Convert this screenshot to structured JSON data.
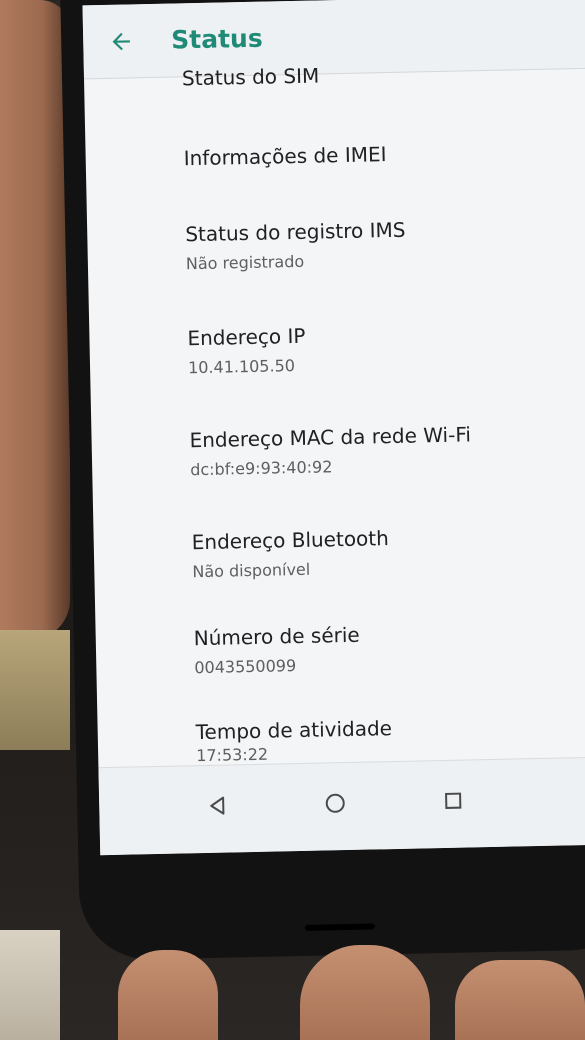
{
  "app_bar": {
    "title": "Status",
    "back_icon": "arrow-left-icon",
    "accent_color": "#1f8a76"
  },
  "items": [
    {
      "title": "Status do SIM",
      "subtitle": ""
    },
    {
      "title": "Informações de IMEI",
      "subtitle": ""
    },
    {
      "title": "Status do registro IMS",
      "subtitle": "Não registrado"
    },
    {
      "title": "Endereço IP",
      "subtitle": "10.41.105.50"
    },
    {
      "title": "Endereço MAC da rede Wi-Fi",
      "subtitle": "dc:bf:e9:93:40:92"
    },
    {
      "title": "Endereço Bluetooth",
      "subtitle": "Não disponível"
    },
    {
      "title": "Número de série",
      "subtitle": "0043550099"
    },
    {
      "title": "Tempo de atividade",
      "subtitle": "17:53:22"
    }
  ],
  "nav_bar": {
    "back_icon": "triangle-back-icon",
    "home_icon": "circle-home-icon",
    "recents_icon": "square-recents-icon"
  }
}
